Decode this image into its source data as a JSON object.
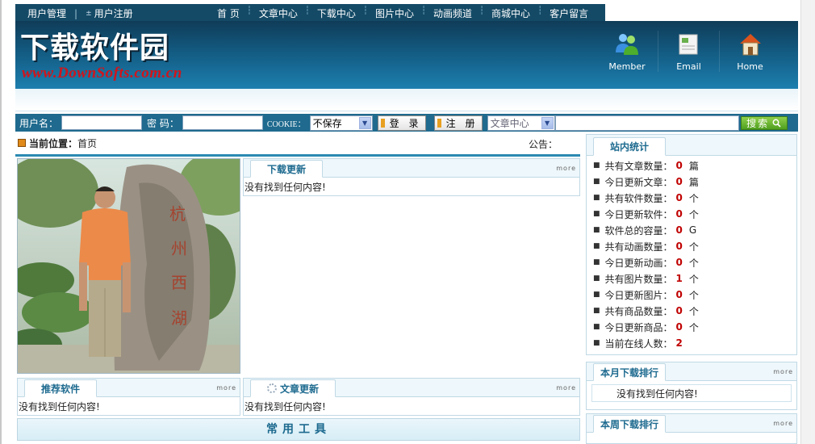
{
  "topnav": {
    "user_admin": "用户管理",
    "user_register": "用户注册",
    "menu": [
      "首 页",
      "文章中心",
      "下载中心",
      "图片中心",
      "动画频道",
      "商城中心",
      "客户留言"
    ]
  },
  "header": {
    "logo_cn": "下载软件园",
    "logo_en": "www.DownSofts.com.cn",
    "icons": [
      {
        "label": "Member",
        "icon": "member-icon"
      },
      {
        "label": "Email",
        "icon": "email-icon"
      },
      {
        "label": "Home",
        "icon": "home-icon"
      }
    ]
  },
  "login": {
    "username_label": "用户名：",
    "password_label": "密 码：",
    "cookie_label": "COOKIE：",
    "cookie_value": "不保存",
    "login_button": "登 录",
    "register_button": "注 册",
    "search_category": "文章中心",
    "search_button": "搜索"
  },
  "breadcrumb": {
    "label": "当前位置：",
    "value": "首页",
    "notice": "公告："
  },
  "panels": {
    "download_updates": {
      "title": "下载更新",
      "more": "more",
      "empty": "没有找到任何内容!"
    },
    "recommended": {
      "title": "推荐软件",
      "more": "more",
      "empty": "没有找到任何内容!"
    },
    "article_updates": {
      "title": "文章更新",
      "more": "more",
      "empty": "没有找到任何内容!"
    },
    "tools": {
      "title": "常用工具"
    }
  },
  "stats": {
    "title": "站内统计",
    "items": [
      {
        "label": "共有文章数量：",
        "value": "0",
        "unit": "篇"
      },
      {
        "label": "今日更新文章：",
        "value": "0",
        "unit": "篇"
      },
      {
        "label": "共有软件数量：",
        "value": "0",
        "unit": "个"
      },
      {
        "label": "今日更新软件：",
        "value": "0",
        "unit": "个"
      },
      {
        "label": "软件总的容量：",
        "value": "0",
        "unit": "G"
      },
      {
        "label": "共有动画数量：",
        "value": "0",
        "unit": "个"
      },
      {
        "label": "今日更新动画：",
        "value": "0",
        "unit": "个"
      },
      {
        "label": "共有图片数量：",
        "value": "1",
        "unit": "个"
      },
      {
        "label": "今日更新图片：",
        "value": "0",
        "unit": "个"
      },
      {
        "label": "共有商品数量：",
        "value": "0",
        "unit": "个"
      },
      {
        "label": "今日更新商品：",
        "value": "0",
        "unit": "个"
      },
      {
        "label": "当前在线人数：",
        "value": "2",
        "unit": ""
      }
    ]
  },
  "month_rank": {
    "title": "本月下载排行",
    "more": "more",
    "empty": "没有找到任何内容!"
  },
  "week_rank": {
    "title": "本周下载排行",
    "more": "more"
  },
  "colors": {
    "nav": "#144a66",
    "accent": "#1d6a8f",
    "value_red": "#c00000"
  }
}
